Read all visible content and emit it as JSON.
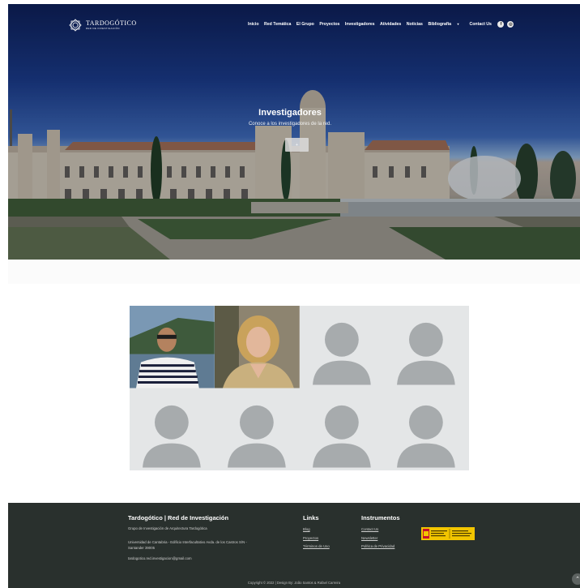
{
  "brand": {
    "name": "TARDOGÓTICO",
    "tagline": "RED DE INVESTIGACIÓN"
  },
  "nav": {
    "items": [
      "Inicio",
      "Red Temática",
      "El Grupo",
      "Proyectos",
      "Investigadores",
      "Atividades",
      "Noticias"
    ],
    "dropdown_label": "Bibliografia",
    "contact_label": "Contact Us",
    "social": [
      {
        "icon": "facebook-icon",
        "glyph": "f"
      },
      {
        "icon": "instagram-icon",
        "glyph": "◎"
      }
    ]
  },
  "hero": {
    "title": "Investigadores",
    "subtitle": "Conoce a los investigadores de la red.",
    "button_label": "+"
  },
  "researchers": [
    {
      "photo": "man-portrait",
      "has_photo": true
    },
    {
      "photo": "woman-portrait",
      "has_photo": true
    },
    {
      "photo": "placeholder-avatar",
      "has_photo": false
    },
    {
      "photo": "placeholder-avatar",
      "has_photo": false
    },
    {
      "photo": "placeholder-avatar",
      "has_photo": false
    },
    {
      "photo": "placeholder-avatar",
      "has_photo": false
    },
    {
      "photo": "placeholder-avatar",
      "has_photo": false
    },
    {
      "photo": "placeholder-avatar",
      "has_photo": false
    }
  ],
  "footer": {
    "title": "Tardogótico | Red de Investigación",
    "description": "Grupo de Investigación de Arquitectura Tardogótica",
    "address": "Universidad de Cantabria - Edificio Interfacultativo Avda. de los Castros S/N - Santander 39005",
    "email": "tardogotico.red.investigacion@gmail.com",
    "links_title": "Links",
    "links": [
      "Blog",
      "Proyectos",
      "Términos de Uso"
    ],
    "instruments_title": "Instrumentos",
    "instruments": [
      "Contact Us",
      "Newsletter",
      "Política de Privacidad"
    ],
    "copyright": "Copyright © 2022 | Design By: João Santos & Rafael Carreira",
    "sponsor_logo": "gobierno-de-espana-logo"
  },
  "colors": {
    "footer_bg": "#29302d",
    "placeholder_bg": "#e4e6e7",
    "placeholder_fg": "#a7abad",
    "sponsor": "#f2c500"
  }
}
